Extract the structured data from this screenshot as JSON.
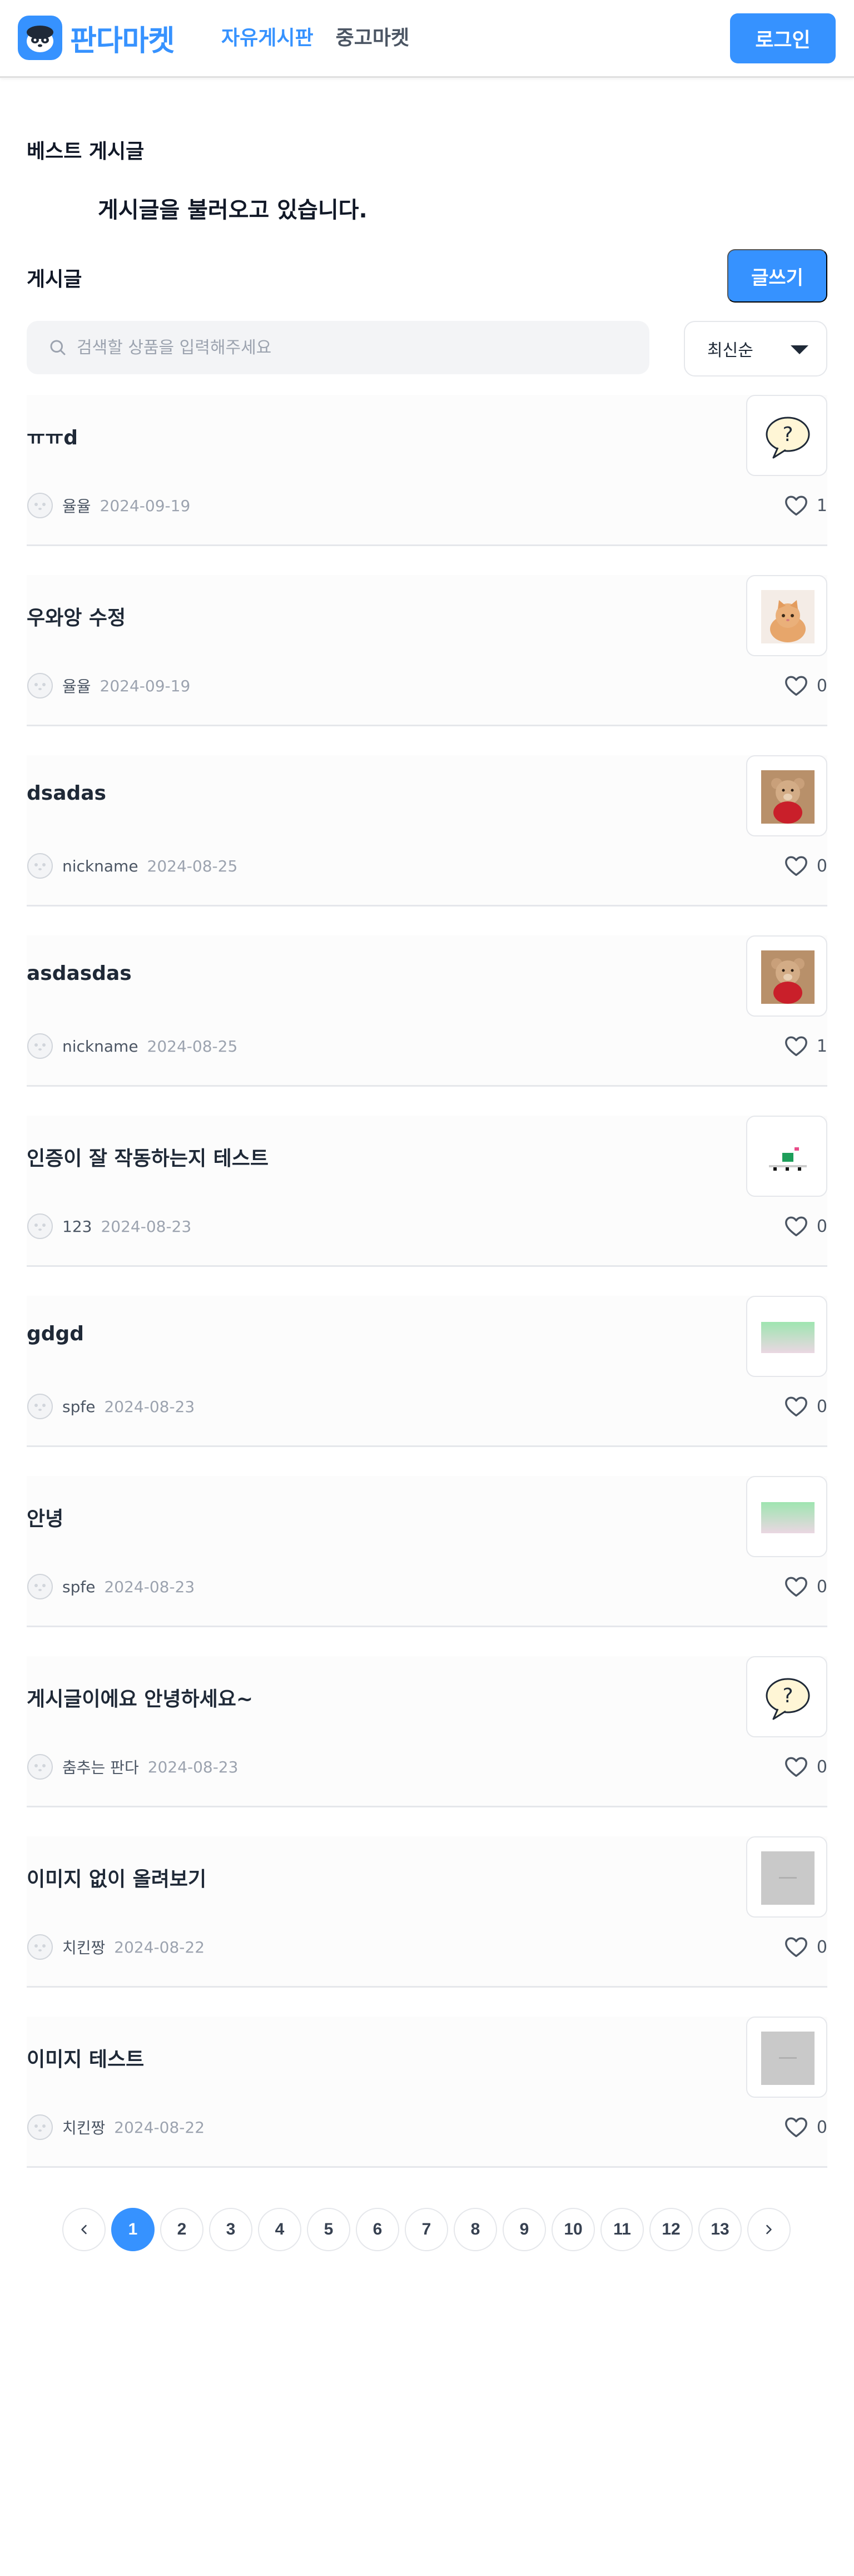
{
  "header": {
    "logo_text": "판다마켓",
    "nav": [
      {
        "label": "자유게시판",
        "active": true
      },
      {
        "label": "중고마켓",
        "active": false
      }
    ],
    "login_label": "로그인"
  },
  "best": {
    "title": "베스트 게시글",
    "loading_text": "게시글을 불러오고 있습니다."
  },
  "posts_section": {
    "title": "게시글",
    "write_label": "글쓰기",
    "search_placeholder": "검색할 상품을 입력해주세요",
    "sort_label": "최신순"
  },
  "posts": [
    {
      "title": "ㅠㅠd",
      "author": "율율",
      "date": "2024-09-19",
      "likes": "1",
      "thumb": "speech-bubble"
    },
    {
      "title": "우와앙 수정",
      "author": "율율",
      "date": "2024-09-19",
      "likes": "0",
      "thumb": "cat"
    },
    {
      "title": "dsadas",
      "author": "nickname",
      "date": "2024-08-25",
      "likes": "0",
      "thumb": "teddy"
    },
    {
      "title": "asdasdas",
      "author": "nickname",
      "date": "2024-08-25",
      "likes": "1",
      "thumb": "teddy"
    },
    {
      "title": "인증이 잘 작동하는지 테스트",
      "author": "123",
      "date": "2024-08-23",
      "likes": "0",
      "thumb": "pixel"
    },
    {
      "title": "gdgd",
      "author": "spfe",
      "date": "2024-08-23",
      "likes": "0",
      "thumb": "gradient"
    },
    {
      "title": "안녕",
      "author": "spfe",
      "date": "2024-08-23",
      "likes": "0",
      "thumb": "gradient"
    },
    {
      "title": "게시글이에요 안녕하세요~",
      "author": "춤추는 판다",
      "date": "2024-08-23",
      "likes": "0",
      "thumb": "speech-bubble"
    },
    {
      "title": "이미지 없이 올려보기",
      "author": "치킨짱",
      "date": "2024-08-22",
      "likes": "0",
      "thumb": "placeholder"
    },
    {
      "title": "이미지 테스트",
      "author": "치킨짱",
      "date": "2024-08-22",
      "likes": "0",
      "thumb": "placeholder"
    }
  ],
  "pagination": {
    "pages": [
      "1",
      "2",
      "3",
      "4",
      "5",
      "6",
      "7",
      "8",
      "9",
      "10",
      "11",
      "12",
      "13"
    ],
    "current": "1"
  },
  "colors": {
    "brand": "#3692ff",
    "divider": "#e5e7eb"
  }
}
